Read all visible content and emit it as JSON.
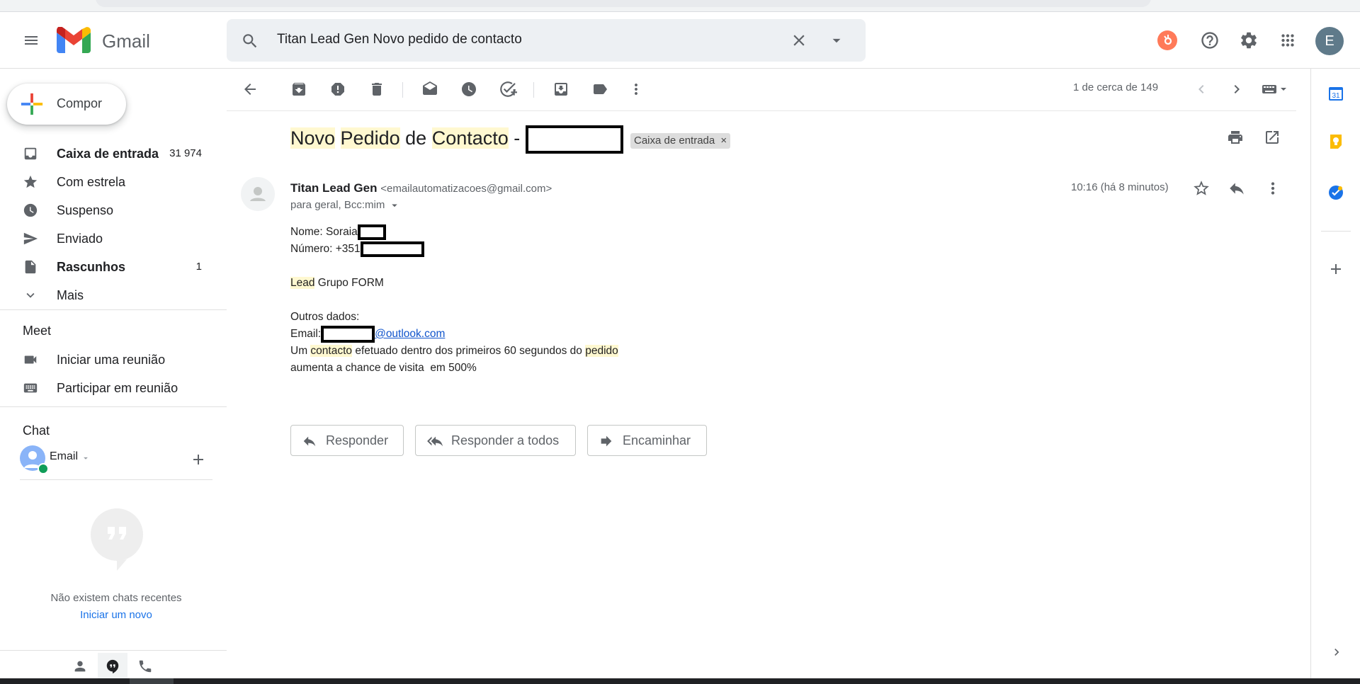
{
  "app": {
    "name": "Gmail",
    "account_initial": "E"
  },
  "search": {
    "query": "Titan Lead Gen Novo pedido de contacto"
  },
  "sidebar": {
    "compose_label": "Compor",
    "items": [
      {
        "label": "Caixa de entrada",
        "count": "31 974",
        "bold": true
      },
      {
        "label": "Com estrela",
        "count": ""
      },
      {
        "label": "Suspenso",
        "count": ""
      },
      {
        "label": "Enviado",
        "count": ""
      },
      {
        "label": "Rascunhos",
        "count": "1",
        "bold": true
      },
      {
        "label": "Mais",
        "count": ""
      }
    ],
    "meet": {
      "title": "Meet",
      "start": "Iniciar uma reunião",
      "join": "Participar em reunião"
    },
    "chat": {
      "title": "Chat",
      "user": "Email",
      "empty_text": "Não existem chats recentes",
      "start_link": "Iniciar um novo"
    }
  },
  "toolbar": {
    "pager": "1 de cerca de 149"
  },
  "message": {
    "subject_words": [
      "Novo",
      "Pedido",
      "de",
      "Contacto",
      "-"
    ],
    "label_chip": "Caixa de entrada",
    "label_chip_close": "×",
    "sender_name": "Titan Lead Gen",
    "sender_email": "<emailautomatizacoes@gmail.com>",
    "recipients": "para geral, Bcc:mim",
    "time": "10:16 (há 8 minutos)",
    "body": {
      "nome": "Nome: Soraia",
      "numero": "Número: +351",
      "lead_word": "Lead",
      "lead_rest": " Grupo FORM",
      "outros": "Outros dados:",
      "email_label": "Email:",
      "email_domain": "@outlook.com",
      "line5_a": "Um ",
      "line5_b": "contacto",
      "line5_c": " efetuado dentro dos primeiros 60 segundos do ",
      "line5_d": "pedido",
      "line6": "aumenta a chance de visita  em 500%"
    }
  },
  "actions": {
    "reply": "Responder",
    "reply_all": "Responder a todos",
    "forward": "Encaminhar"
  },
  "colors": {
    "gmail_red": "#ea4335",
    "link_blue": "#1a73e8",
    "highlight": "#fff8d0",
    "account_avatar": "#5f7a8a"
  }
}
